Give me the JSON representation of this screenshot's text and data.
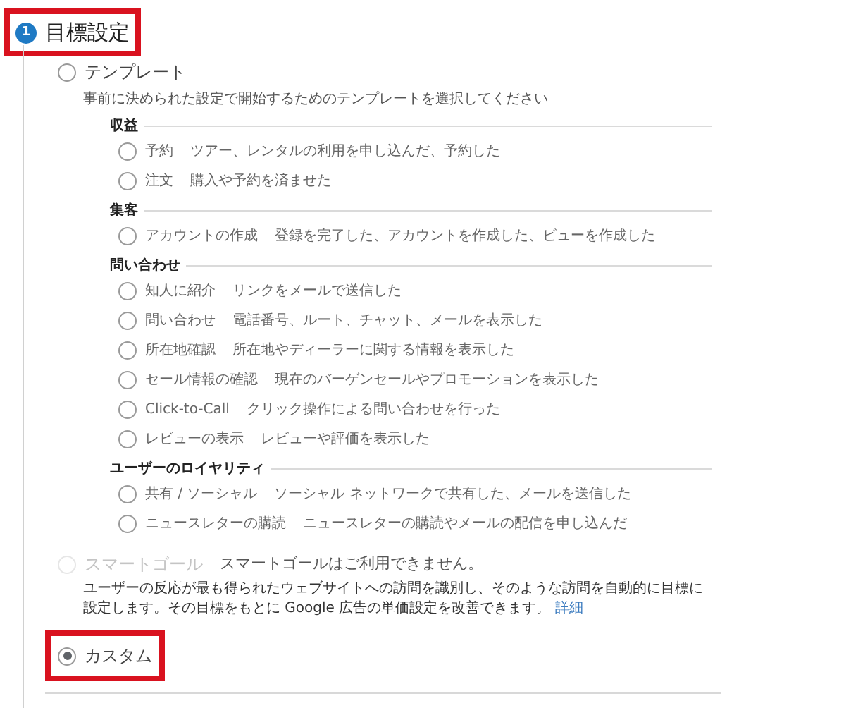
{
  "goal_setting": {
    "step_number": "1",
    "title": "目標設定",
    "highlighted": true,
    "options": [
      {
        "kind": "template",
        "label": "テンプレート",
        "selected": false,
        "disabled": false,
        "highlighted": false,
        "description": "事前に決められた設定で開始するためのテンプレートを選択してください",
        "groups": [
          {
            "heading": "収益",
            "items": [
              {
                "name": "予約",
                "description": "ツアー、レンタルの利用を申し込んだ、予約した",
                "selected": false
              },
              {
                "name": "注文",
                "description": "購入や予約を済ませた",
                "selected": false
              }
            ]
          },
          {
            "heading": "集客",
            "items": [
              {
                "name": "アカウントの作成",
                "description": "登録を完了した、アカウントを作成した、ビューを作成した",
                "selected": false
              }
            ]
          },
          {
            "heading": "問い合わせ",
            "items": [
              {
                "name": "知人に紹介",
                "description": "リンクをメールで送信した",
                "selected": false
              },
              {
                "name": "問い合わせ",
                "description": "電話番号、ルート、チャット、メールを表示した",
                "selected": false
              },
              {
                "name": "所在地確認",
                "description": "所在地やディーラーに関する情報を表示した",
                "selected": false
              },
              {
                "name": "セール情報の確認",
                "description": "現在のバーゲンセールやプロモーションを表示した",
                "selected": false
              },
              {
                "name": "Click-to-Call",
                "description": "クリック操作による問い合わせを行った",
                "selected": false
              },
              {
                "name": "レビューの表示",
                "description": "レビューや評価を表示した",
                "selected": false
              }
            ]
          },
          {
            "heading": "ユーザーのロイヤリティ",
            "items": [
              {
                "name": "共有 / ソーシャル",
                "description": "ソーシャル ネットワークで共有した、メールを送信した",
                "selected": false
              },
              {
                "name": "ニュースレターの購読",
                "description": "ニュースレターの購読やメールの配信を申し込んだ",
                "selected": false
              }
            ]
          }
        ]
      },
      {
        "kind": "smart",
        "label": "スマートゴール",
        "selected": false,
        "disabled": true,
        "highlighted": false,
        "note": "スマートゴールはご利用できません。",
        "description": "ユーザーの反応が最も得られたウェブサイトへの訪問を識別し、そのような訪問を自動的に目標に設定します。その目標をもとに Google 広告の単価設定を改善できます。",
        "link": "詳細"
      },
      {
        "kind": "custom",
        "label": "カスタム",
        "selected": true,
        "disabled": false,
        "highlighted": true
      }
    ]
  }
}
